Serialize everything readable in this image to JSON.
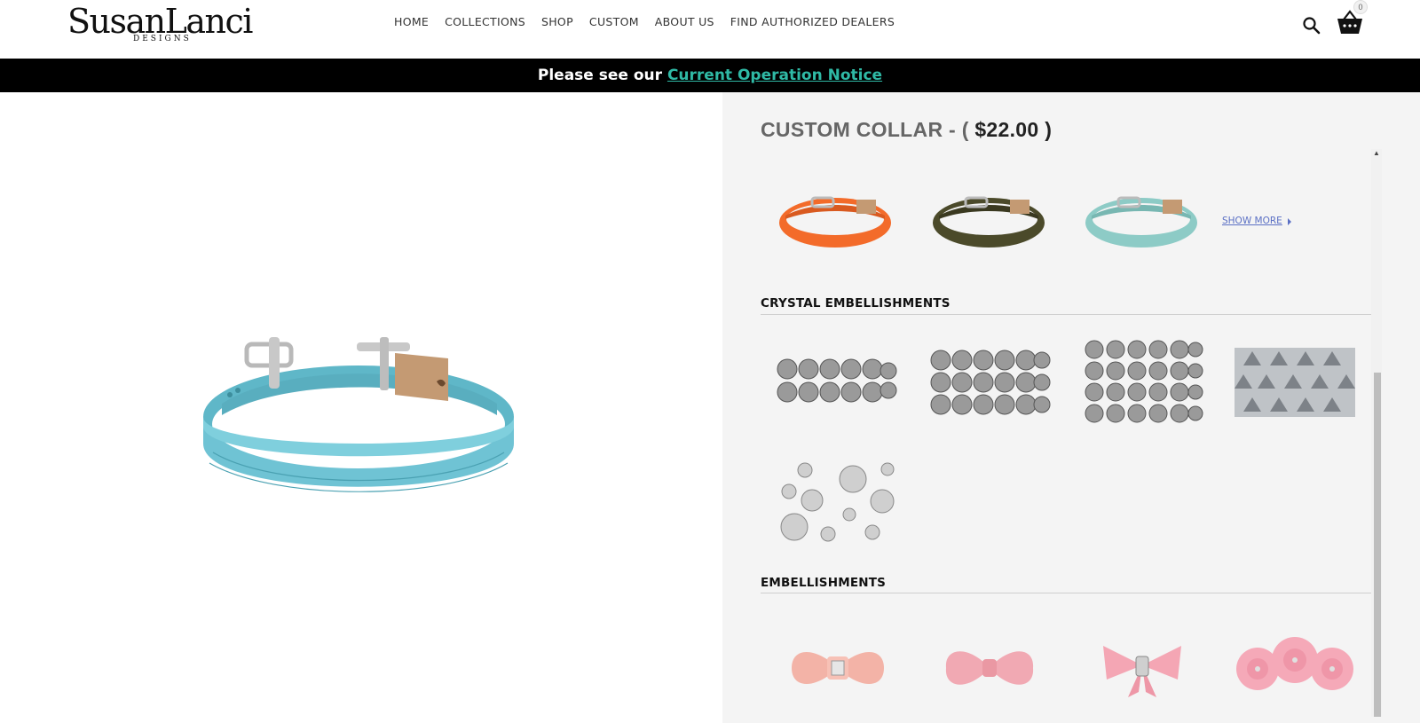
{
  "brand": {
    "name": "SusanLanci",
    "sub": "DESIGNS"
  },
  "nav": [
    "HOME",
    "COLLECTIONS",
    "SHOP",
    "CUSTOM",
    "ABOUT US",
    "FIND AUTHORIZED DEALERS"
  ],
  "cart": {
    "count": "0"
  },
  "notice": {
    "text": "Please see our ",
    "link": "Current Operation Notice"
  },
  "product": {
    "title": "CUSTOM COLLAR - ( ",
    "price": "$22.00",
    "title_end": " )"
  },
  "collar_colors": [
    {
      "name": "orange-collar",
      "color": "#f36b2a"
    },
    {
      "name": "olive-collar",
      "color": "#4b4a2a"
    },
    {
      "name": "aqua-collar",
      "color": "#8dcbc6"
    }
  ],
  "show_more": "SHOW MORE",
  "sections": {
    "crystal": "CRYSTAL EMBELLISHMENTS",
    "embellishments": "EMBELLISHMENTS"
  },
  "colors": {
    "accent": "#2fb9a5",
    "link": "#5a6fc4",
    "main_collar": "#6fc3d4"
  }
}
